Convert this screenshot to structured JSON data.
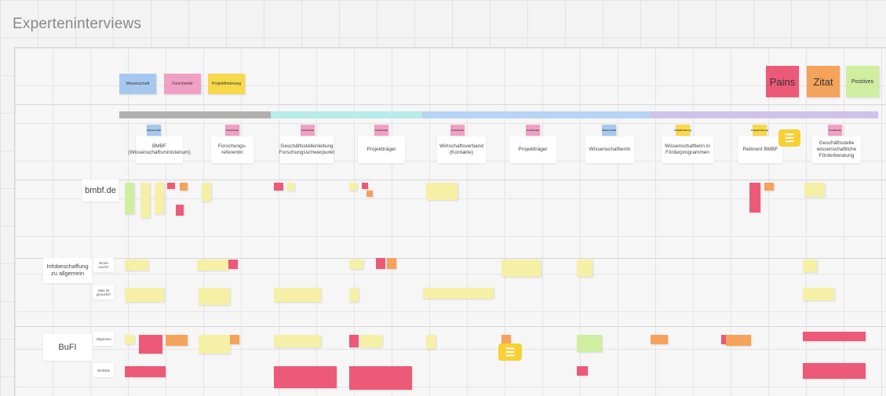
{
  "board": {
    "title": "Experteninterviews"
  },
  "legend": {
    "small": [
      {
        "label": "Wissenschaft",
        "color": "blue"
      },
      {
        "label": "Forschende",
        "color": "pink"
      },
      {
        "label": "Projektförderung",
        "color": "yellow"
      }
    ],
    "large": [
      {
        "label": "Pains",
        "color": "red"
      },
      {
        "label": "Zitat",
        "color": "orange"
      },
      {
        "label": "Positives",
        "color": "green"
      }
    ]
  },
  "columns": [
    {
      "label": "BMBF (Wissenschaftsministerium)",
      "tag": "Wissenschaft",
      "tag_color": "blue"
    },
    {
      "label": "Forschungs-referentin",
      "tag": "Forschende",
      "tag_color": "pink"
    },
    {
      "label": "Geschäftsstellenleitung Forschungsschwerpunkt",
      "tag": "Forschende",
      "tag_color": "pink"
    },
    {
      "label": "Projektträger",
      "tag": "Forschende",
      "tag_color": "pink"
    },
    {
      "label": "Wirtschaftsverband (Kontakte)",
      "tag": "Forschende",
      "tag_color": "pink"
    },
    {
      "label": "Projektträger",
      "tag": "Forschende",
      "tag_color": "pink"
    },
    {
      "label": "Wissenschaftler/in",
      "tag": "Wissenschaft",
      "tag_color": "blue"
    },
    {
      "label": "Wissenschaftlerin in Förderprogrammen",
      "tag": "Projektförderung",
      "tag_color": "yellow"
    },
    {
      "label": "Referent BMBF",
      "tag": "Projektförderung",
      "tag_color": "yellow"
    },
    {
      "label": "Geschäftsstelle wissenschaftliche Förderberatung",
      "tag": "Forschende",
      "tag_color": "pink"
    }
  ],
  "rows": [
    {
      "label": "bmbf.de"
    },
    {
      "label": "Infobeschaffung zu allgemein",
      "sub": [
        "Worte sucht?",
        "Was ist gesucht?"
      ]
    },
    {
      "label": "BuFI",
      "sub": [
        "Allgemein",
        "Website"
      ]
    }
  ]
}
